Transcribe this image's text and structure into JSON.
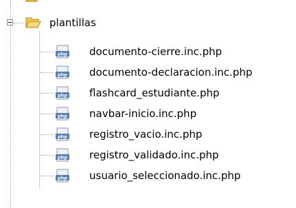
{
  "tree": {
    "folder": {
      "name": "plantillas",
      "icon": "folder-open-icon",
      "expanded": true
    },
    "files": [
      {
        "name": "documento-cierre.inc.php",
        "icon": "php-file-icon"
      },
      {
        "name": "documento-declaracion.inc.php",
        "icon": "php-file-icon"
      },
      {
        "name": "flashcard_estudiante.php",
        "icon": "php-file-icon"
      },
      {
        "name": "navbar-inicio.inc.php",
        "icon": "php-file-icon"
      },
      {
        "name": "registro_vacio.inc.php",
        "icon": "php-file-icon"
      },
      {
        "name": "registro_validado.inc.php",
        "icon": "php-file-icon"
      },
      {
        "name": "usuario_seleccionado.inc.php",
        "icon": "php-file-icon"
      }
    ]
  },
  "colors": {
    "folder": "#e8b83a",
    "php_icon": "#5a7fb0",
    "tree_line": "#a0a0a0"
  }
}
